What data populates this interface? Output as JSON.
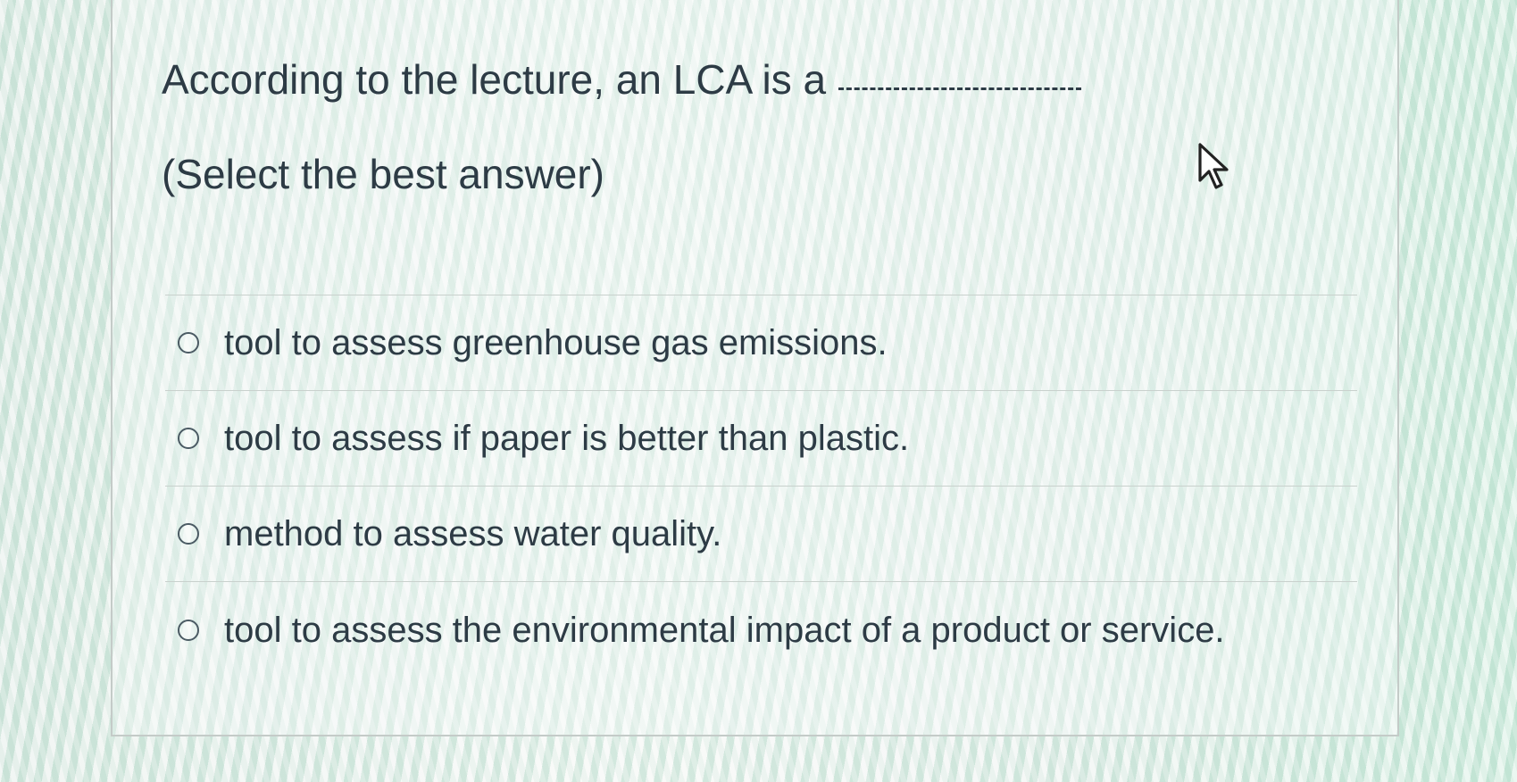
{
  "question": {
    "text": "According to the lecture, an LCA is a",
    "instruction": "(Select the best answer)"
  },
  "answers": [
    {
      "label": "tool to assess greenhouse gas emissions.",
      "selected": false
    },
    {
      "label": "tool to assess if paper is better than plastic.",
      "selected": false
    },
    {
      "label": "method to assess water quality.",
      "selected": false
    },
    {
      "label": "tool to assess the environmental impact of a product or service.",
      "selected": false
    }
  ],
  "cursor": {
    "icon": "mouse-pointer-icon"
  }
}
